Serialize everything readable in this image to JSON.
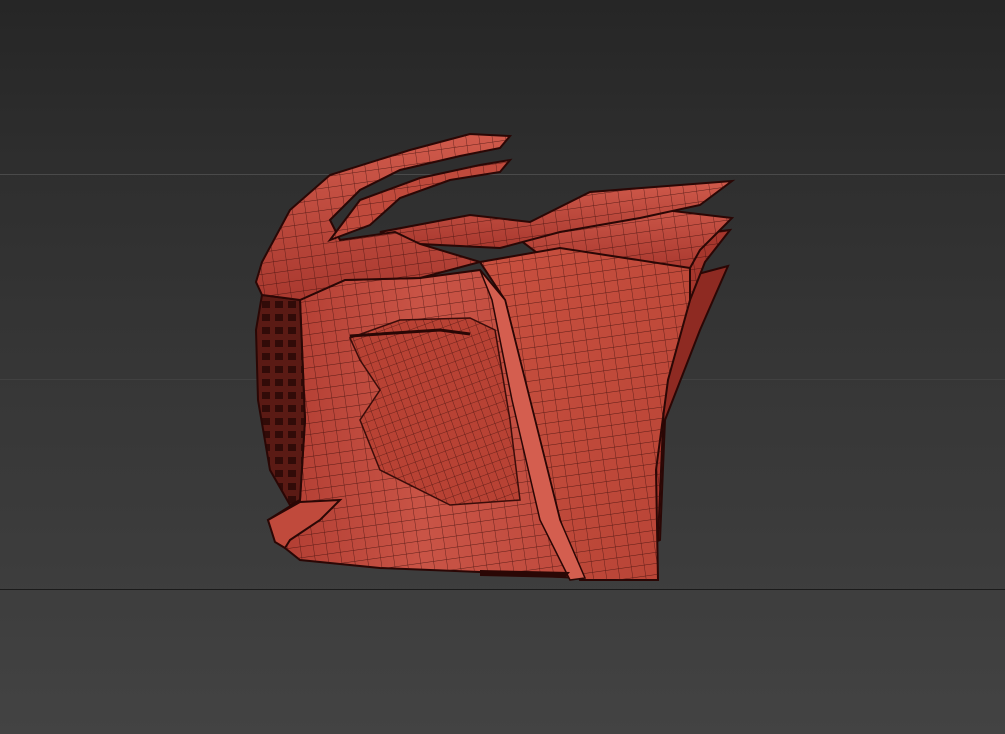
{
  "viewport": {
    "background_top": "#262626",
    "background_bottom": "#434343",
    "shading_mode": "edged-faces"
  },
  "model": {
    "surface_color": "#c0483b",
    "wire_color": "#3a0d0a",
    "edge_color": "#2a0705"
  }
}
